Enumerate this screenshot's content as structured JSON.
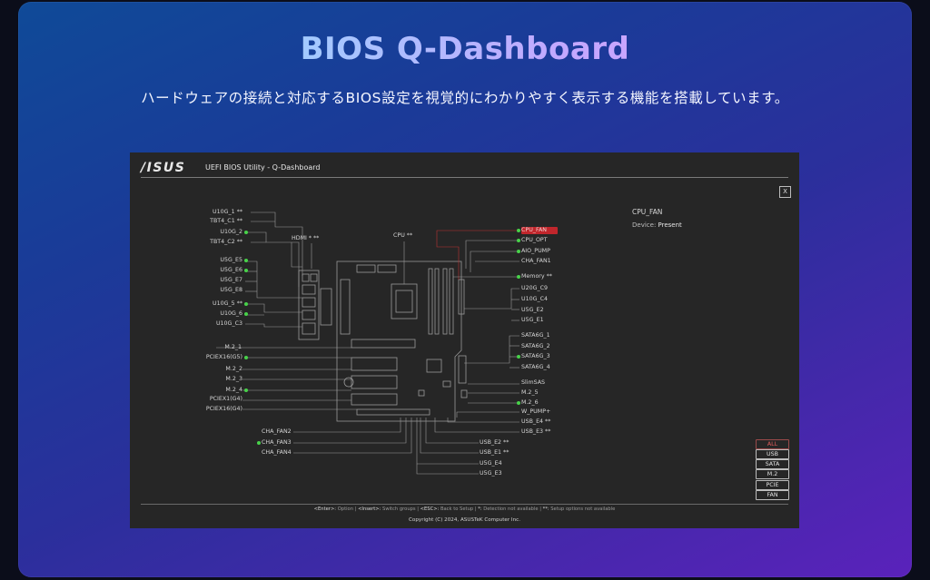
{
  "hero": {
    "title": "BIOS Q-Dashboard",
    "subtitle": "ハードウェアの接続と対応するBIOS設定を視覚的にわかりやすく表示する機能を搭載しています。"
  },
  "bios": {
    "logo": "/ISUS",
    "title": "UEFI BIOS Utility - Q-Dashboard",
    "close_label": "X",
    "colors": {
      "selected": "#c0262c",
      "connected_dot": "#48d24a",
      "panel": "#262626"
    }
  },
  "left_labels": [
    {
      "text": "U10G_1 **",
      "dot": false
    },
    {
      "text": "TBT4_C1 **",
      "dot": false
    },
    {
      "text": "U10G_2",
      "dot": true
    },
    {
      "text": "TBT4_C2 **",
      "dot": false
    },
    {
      "text": "U5G_E5",
      "dot": true
    },
    {
      "text": "U5G_E6",
      "dot": true
    },
    {
      "text": "U5G_E7",
      "dot": false
    },
    {
      "text": "U5G_E8",
      "dot": false
    },
    {
      "text": "U10G_5 **",
      "dot": true
    },
    {
      "text": "U10G_6",
      "dot": true
    },
    {
      "text": "U10G_C3",
      "dot": false
    },
    {
      "text": "M.2_1",
      "dot": false
    },
    {
      "text": "PCIEX16(G5)",
      "dot": true
    },
    {
      "text": "M.2_2",
      "dot": false
    },
    {
      "text": "M.2_3",
      "dot": false
    },
    {
      "text": "M.2_4",
      "dot": true
    },
    {
      "text": "PCIEX1(G4)",
      "dot": false
    },
    {
      "text": "PCIEX16(G4)",
      "dot": false
    }
  ],
  "top_labels": {
    "hdmi": "HDMI * **",
    "cpu": "CPU **"
  },
  "right_labels": [
    {
      "text": "CPU_FAN",
      "dot": true,
      "selected": true
    },
    {
      "text": "CPU_OPT",
      "dot": true,
      "selected": false
    },
    {
      "text": "AIO_PUMP",
      "dot": true,
      "selected": false
    },
    {
      "text": "CHA_FAN1",
      "dot": false,
      "selected": false
    },
    {
      "text": "Memory **",
      "dot": true,
      "selected": false
    },
    {
      "text": "U20G_C9",
      "dot": false,
      "selected": false
    },
    {
      "text": "U10G_C4",
      "dot": false,
      "selected": false
    },
    {
      "text": "U5G_E2",
      "dot": false,
      "selected": false
    },
    {
      "text": "U5G_E1",
      "dot": false,
      "selected": false
    },
    {
      "text": "SATA6G_1",
      "dot": false,
      "selected": false
    },
    {
      "text": "SATA6G_2",
      "dot": false,
      "selected": false
    },
    {
      "text": "SATA6G_3",
      "dot": true,
      "selected": false
    },
    {
      "text": "SATA6G_4",
      "dot": false,
      "selected": false
    },
    {
      "text": "SlimSAS",
      "dot": false,
      "selected": false
    },
    {
      "text": "M.2_5",
      "dot": false,
      "selected": false
    },
    {
      "text": "M.2_6",
      "dot": true,
      "selected": false
    },
    {
      "text": "W_PUMP+",
      "dot": false,
      "selected": false
    },
    {
      "text": "USB_E4 **",
      "dot": false,
      "selected": false
    },
    {
      "text": "USB_E3 **",
      "dot": false,
      "selected": false
    }
  ],
  "bottom_left_labels": [
    {
      "text": "CHA_FAN2",
      "dot": false
    },
    {
      "text": "CHA_FAN3",
      "dot": true
    },
    {
      "text": "CHA_FAN4",
      "dot": false
    }
  ],
  "bottom_center_labels": [
    {
      "text": "USB_E2 **",
      "dot": false
    },
    {
      "text": "USB_E1 **",
      "dot": false
    },
    {
      "text": "U5G_E4",
      "dot": false
    },
    {
      "text": "U5G_E3",
      "dot": false
    }
  ],
  "info": {
    "title": "CPU_FAN",
    "device_label": "Device: ",
    "device_value": "Present"
  },
  "filters": [
    {
      "label": "ALL",
      "active": true
    },
    {
      "label": "USB",
      "active": false
    },
    {
      "label": "SATA",
      "active": false
    },
    {
      "label": "M.2",
      "active": false
    },
    {
      "label": "PCIE",
      "active": false
    },
    {
      "label": "FAN",
      "active": false
    }
  ],
  "footer": {
    "hints": [
      {
        "key": "<Enter>:",
        "desc": " Option"
      },
      {
        "key": "<Insert>:",
        "desc": " Switch groups"
      },
      {
        "key": "<ESC>:",
        "desc": " Back to Setup"
      },
      {
        "key": "*:",
        "desc": " Detection not available"
      },
      {
        "key": "**:",
        "desc": " Setup options not available"
      }
    ],
    "copyright": "Copyright (C) 2024, ASUSTeK Computer Inc."
  }
}
